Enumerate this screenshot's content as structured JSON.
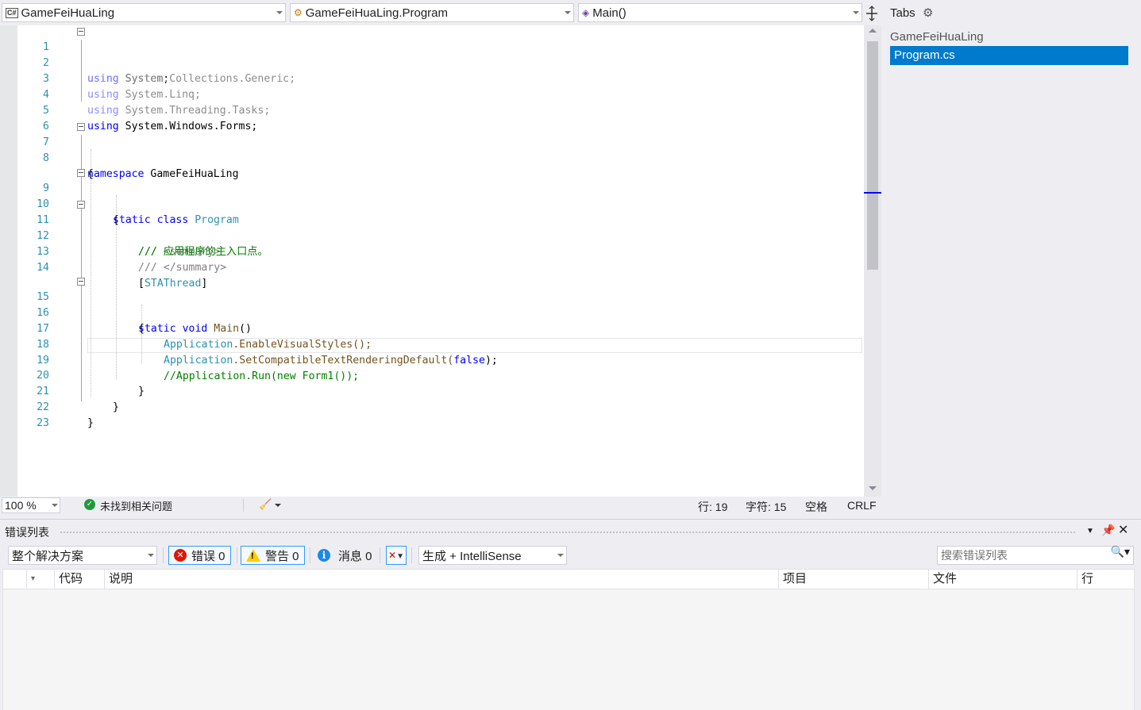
{
  "navbar": {
    "project": "GameFeiHuaLing",
    "class": "GameFeiHuaLing.Program",
    "member": "Main()",
    "project_icon": "csharp-project-icon",
    "class_icon": "class-icon",
    "member_icon": "method-icon"
  },
  "editor": {
    "lines": [
      {
        "n": "1"
      },
      {
        "n": "2"
      },
      {
        "n": "3"
      },
      {
        "n": "4"
      },
      {
        "n": "5"
      },
      {
        "n": "6"
      },
      {
        "n": "7"
      },
      {
        "n": "8"
      },
      {
        "n": "9"
      },
      {
        "n": "10"
      },
      {
        "n": "11"
      },
      {
        "n": "12"
      },
      {
        "n": "13"
      },
      {
        "n": "14"
      },
      {
        "n": "15"
      },
      {
        "n": "16"
      },
      {
        "n": "17"
      },
      {
        "n": "18"
      },
      {
        "n": "19"
      },
      {
        "n": "20"
      },
      {
        "n": "21"
      },
      {
        "n": "22"
      },
      {
        "n": "23"
      }
    ],
    "code": {
      "l1_kw": "using",
      "l1_rest": " System;",
      "l2_kw": "using",
      "l2_rest": " System.Collections.Generic;",
      "l3_kw": "using",
      "l3_rest": " System.Linq;",
      "l4_kw": "using",
      "l4_rest": " System.Threading.Tasks;",
      "l5_kw": "using",
      "l5_rest": " System.Windows.Forms;",
      "l7_kw": "namespace",
      "l7_rest": " GameFeiHuaLing",
      "l8": "{",
      "l9_kw": "static class",
      "l9_type": "Program",
      "l10": "{",
      "l11_c": "/// ",
      "l11_t": "<summary>",
      "l12_c": "/// 应用程序的主入口点。",
      "l13_c": "/// ",
      "l13_t": "</summary>",
      "l14_a": "[",
      "l14_t": "STAThread",
      "l14_b": "]",
      "l15_kw": "static void",
      "l15_name": "Main",
      "l15_rest": "()",
      "l16": "{",
      "l17_t": "Application",
      "l17_rest": ".EnableVisualStyles();",
      "l18_t": "Application",
      "l18_m": ".SetCompatibleTextRenderingDefault(",
      "l18_kw": "false",
      "l18_e": ");",
      "l19_c": "//Application.Run(new Form1());",
      "l20": "}",
      "l21": "}",
      "l22": "}"
    }
  },
  "status": {
    "zoom": "100 %",
    "issues": "未找到相关问题",
    "line": "行: 19",
    "char": "字符: 15",
    "indent": "空格",
    "eol": "CRLF"
  },
  "tabs": {
    "title": "Tabs",
    "project": "GameFeiHuaLing",
    "file": "Program.cs"
  },
  "error_list": {
    "title": "错误列表",
    "scope": "整个解决方案",
    "errors": "错误 0",
    "warnings": "警告 0",
    "messages": "消息 0",
    "source": "生成 + IntelliSense",
    "search_placeholder": "搜索错误列表",
    "columns": {
      "code": "代码",
      "description": "说明",
      "project": "项目",
      "file": "文件",
      "line": "行"
    }
  },
  "colors": {
    "keyword": "#0000ff",
    "type": "#2b91af",
    "comment": "#008000",
    "selection": "#007acc",
    "error": "#e51400",
    "warning": "#ffcc00",
    "info": "#1e88e5"
  }
}
